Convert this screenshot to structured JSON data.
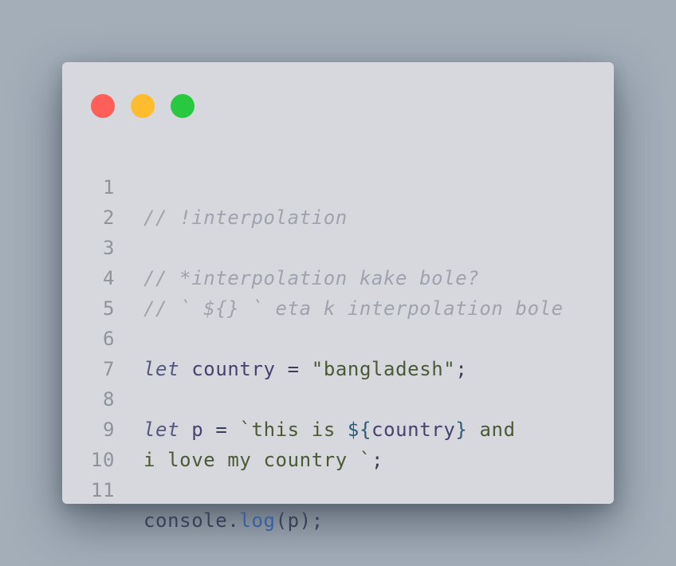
{
  "window": {
    "traffic_lights": {
      "close_color": "#ff5f57",
      "minimize_color": "#febc2e",
      "maximize_color": "#28c840"
    }
  },
  "code": {
    "language": "javascript",
    "lines": [
      {
        "number": "1",
        "comment": "// !interpolation"
      },
      {
        "number": "2"
      },
      {
        "number": "3",
        "comment": "// *interpolation kake bole?"
      },
      {
        "number": "4",
        "comment": "// ` ${} ` eta k interpolation bole"
      },
      {
        "number": "5"
      },
      {
        "number": "6",
        "keyword": "let",
        "ident": "country",
        "op": "=",
        "string": "\"bangladesh\"",
        "end": ";"
      },
      {
        "number": "7"
      },
      {
        "number": "8",
        "keyword": "let",
        "ident": "p",
        "op": "=",
        "string_start": "`this is ",
        "interp_open": "${",
        "interp_var": "country",
        "interp_close": "}",
        "string_end": " and"
      },
      {
        "number": "9",
        "string": "i love my country `",
        "end": ";"
      },
      {
        "number": "10"
      },
      {
        "number": "11",
        "object": "console",
        "dot": ".",
        "method": "log",
        "args": "(p);"
      }
    ]
  }
}
